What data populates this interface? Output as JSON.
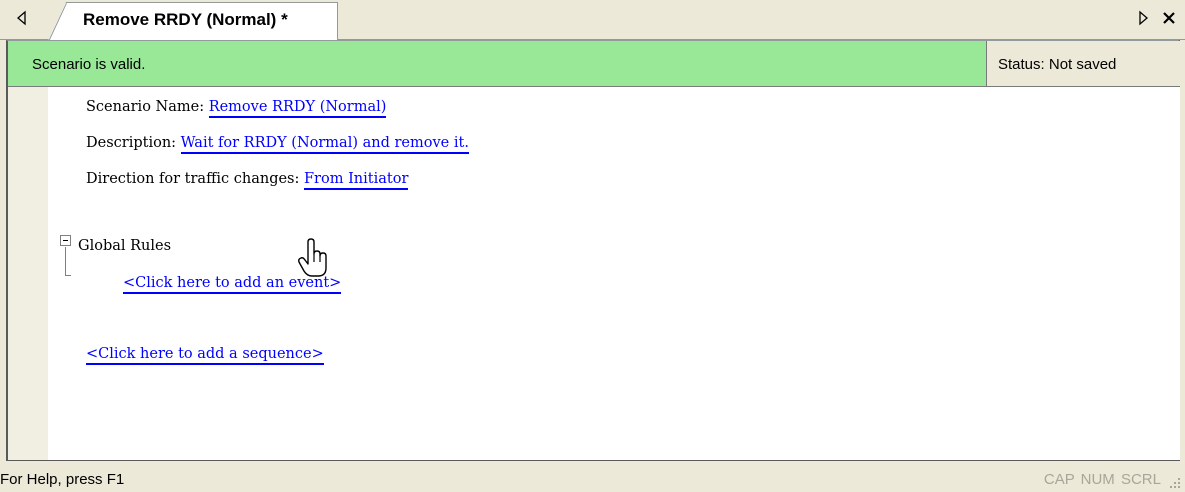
{
  "tab": {
    "title": "Remove RRDY (Normal) *",
    "nav_left_icon": "triangle-left-icon",
    "nav_right_icon": "triangle-right-icon",
    "close_icon": "close-icon"
  },
  "validation": {
    "message": "Scenario is valid.",
    "status": "Status: Not saved",
    "color": "#98e898"
  },
  "scenario": {
    "name_label": "Scenario Name:",
    "name_value": "Remove RRDY (Normal)",
    "description_label": "Description:",
    "description_value": "Wait for RRDY (Normal) and remove it.",
    "direction_label": "Direction for traffic changes:",
    "direction_value": "From Initiator"
  },
  "global_rules": {
    "label": "Global Rules",
    "add_event_link": "<Click here to add an event>"
  },
  "add_sequence_link": "<Click here to add a sequence>",
  "statusbar": {
    "help_text": "For Help, press F1",
    "indicators": "CAP NUM SCRL"
  },
  "colors": {
    "link": "#0000ff",
    "chrome": "#ece9d8"
  }
}
